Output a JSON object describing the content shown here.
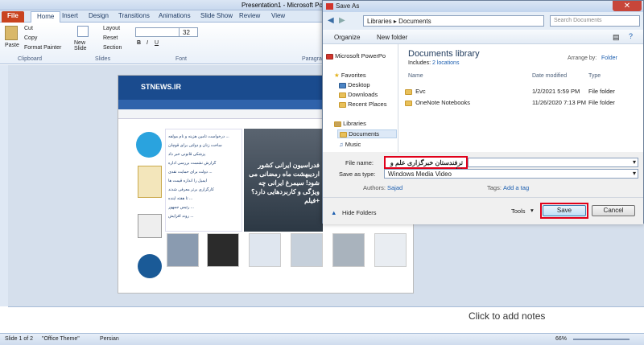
{
  "app": {
    "title": "Presentation1 - Microsoft PowerPoint",
    "tabs": [
      "File",
      "Home",
      "Insert",
      "Design",
      "Transitions",
      "Animations",
      "Slide Show",
      "Review",
      "View"
    ],
    "active_tab": "Home"
  },
  "ribbon": {
    "clipboard": {
      "paste": "Paste",
      "cut": "Cut",
      "copy": "Copy",
      "format_painter": "Format Painter",
      "label": "Clipboard"
    },
    "slides": {
      "new_slide": "New Slide",
      "layout": "Layout",
      "reset": "Reset",
      "section": "Section",
      "label": "Slides"
    },
    "font": {
      "size": "32",
      "label": "Font"
    },
    "paragraph": {
      "label": "Paragra"
    }
  },
  "slide": {
    "site_logo": "STNEWS.IR",
    "headline": "فدراسیون ایرانی کشور اردیبهشت ماه رمضانی می شود! سیمرغ ایرانی چه ویژگی و کاربردهایی دارد؟ +فیلم",
    "news_items": [
      "درخواست تامین هزینه و نام مولفه ...",
      "ساخت زنان و دولتی برای قوچان",
      "پزشکی قانونی خبر داد",
      "گزارش نشست بررسی اداره",
      "دولت برای حمایت نقدی ...",
      "ایمیل را اندازه قیمت ها",
      "کارگزاری برتر معرفی شدند",
      "تا هفته آینده ...",
      "رئیس جمهور ...",
      "روند افزایش ..."
    ]
  },
  "notes": {
    "placeholder": "Click to add notes"
  },
  "status": {
    "slide": "Slide 1 of 2",
    "theme": "\"Office Theme\"",
    "language": "Persian",
    "zoom": "66%"
  },
  "dialog": {
    "title": "Save As",
    "address": [
      "Libraries",
      "Documents"
    ],
    "search_placeholder": "Search Documents",
    "organize": "Organize",
    "new_folder": "New folder",
    "nav": [
      {
        "label": "Microsoft PowerPo",
        "icon": "ppt-icon"
      },
      {
        "label": "Favorites",
        "icon": "star-icon"
      },
      {
        "label": "Desktop",
        "icon": "desktop-icon"
      },
      {
        "label": "Downloads",
        "icon": "downloads-icon"
      },
      {
        "label": "Recent Places",
        "icon": "recent-icon"
      },
      {
        "label": "Libraries",
        "icon": "library-icon"
      },
      {
        "label": "Documents",
        "icon": "documents-icon"
      },
      {
        "label": "Music",
        "icon": "music-icon"
      }
    ],
    "library_title": "Documents library",
    "includes_label": "Includes:",
    "includes_link": "2 locations",
    "arrange_label": "Arrange by:",
    "arrange_value": "Folder",
    "columns": {
      "name": "Name",
      "date": "Date modified",
      "type": "Type"
    },
    "files": [
      {
        "name": "Evc",
        "date": "1/2/2021 5:59 PM",
        "type": "File folder"
      },
      {
        "name": "OneNote Notebooks",
        "date": "11/26/2020 7:13 PM",
        "type": "File folder"
      }
    ],
    "file_name_label": "File name:",
    "file_name_value": "ترفندستان خبرگزاری علم و فناوری",
    "save_type_label": "Save as type:",
    "save_type_value": "Windows Media Video",
    "authors_label": "Authors:",
    "authors_value": "Sajad",
    "tags_label": "Tags:",
    "tags_value": "Add a tag",
    "hide_folders": "Hide Folders",
    "tools": "Tools",
    "save": "Save",
    "cancel": "Cancel"
  }
}
